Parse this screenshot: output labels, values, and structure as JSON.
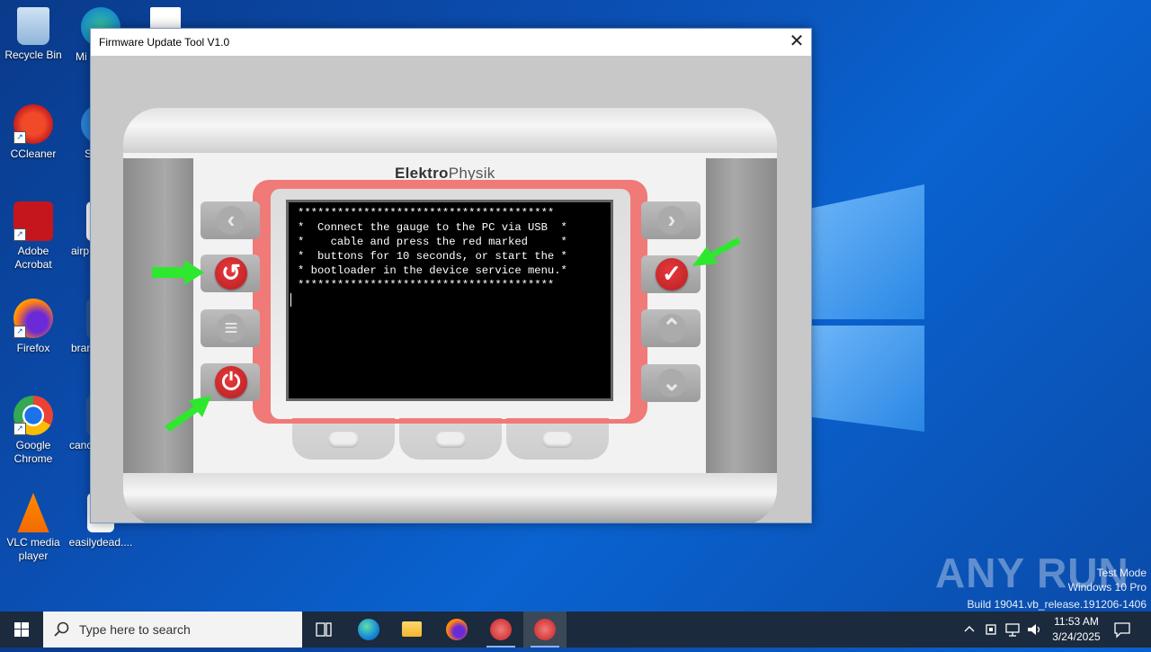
{
  "desktop": {
    "icons": [
      {
        "label": "Recycle Bin"
      },
      {
        "label": "CCleaner"
      },
      {
        "label": "Adobe Acrobat"
      },
      {
        "label": "Firefox"
      },
      {
        "label": "Google Chrome"
      },
      {
        "label": "VLC media player"
      },
      {
        "label": "Mi"
      },
      {
        "label": "S"
      },
      {
        "label": "airp"
      },
      {
        "label": "bran"
      },
      {
        "label": "canc"
      },
      {
        "label": "easilydead...."
      }
    ],
    "watermark": {
      "line1": "Test Mode",
      "line2": "Windows 10 Pro",
      "line3": "Build 19041.vb_release.191206-1406"
    },
    "brand_watermark": "ANY RUN"
  },
  "window": {
    "title": "Firmware Update Tool V1.0",
    "close_glyph": "✕"
  },
  "device": {
    "brand_bold": "Elektro",
    "brand_light": "Physik",
    "screen_text": "***************************************\n*  Connect the gauge to the PC via USB  *\n*    cable and press the red marked     *\n*  buttons for 10 seconds, or start the *\n* bootloader in the device service menu.*\n***************************************",
    "left_buttons": [
      {
        "glyph": "‹",
        "icon": "chevron-left-icon"
      },
      {
        "glyph": "↺",
        "icon": "reset-icon"
      },
      {
        "glyph": "≡",
        "icon": "menu-icon"
      },
      {
        "glyph": "⏻",
        "icon": "power-icon"
      }
    ],
    "right_buttons": [
      {
        "glyph": "›",
        "icon": "chevron-right-icon"
      },
      {
        "glyph": "✓",
        "icon": "confirm-check-icon"
      },
      {
        "glyph": "⌃",
        "icon": "chevron-up-icon"
      },
      {
        "glyph": "⌄",
        "icon": "chevron-down-icon"
      }
    ]
  },
  "taskbar": {
    "search_placeholder": "Type here to search",
    "time": "11:53 AM",
    "date": "3/24/2025"
  },
  "colors": {
    "accent_red": "#f07a78",
    "button_red": "#d32b2e",
    "arrow_green": "#2ee82e",
    "taskbar": "#1b2a3c"
  }
}
